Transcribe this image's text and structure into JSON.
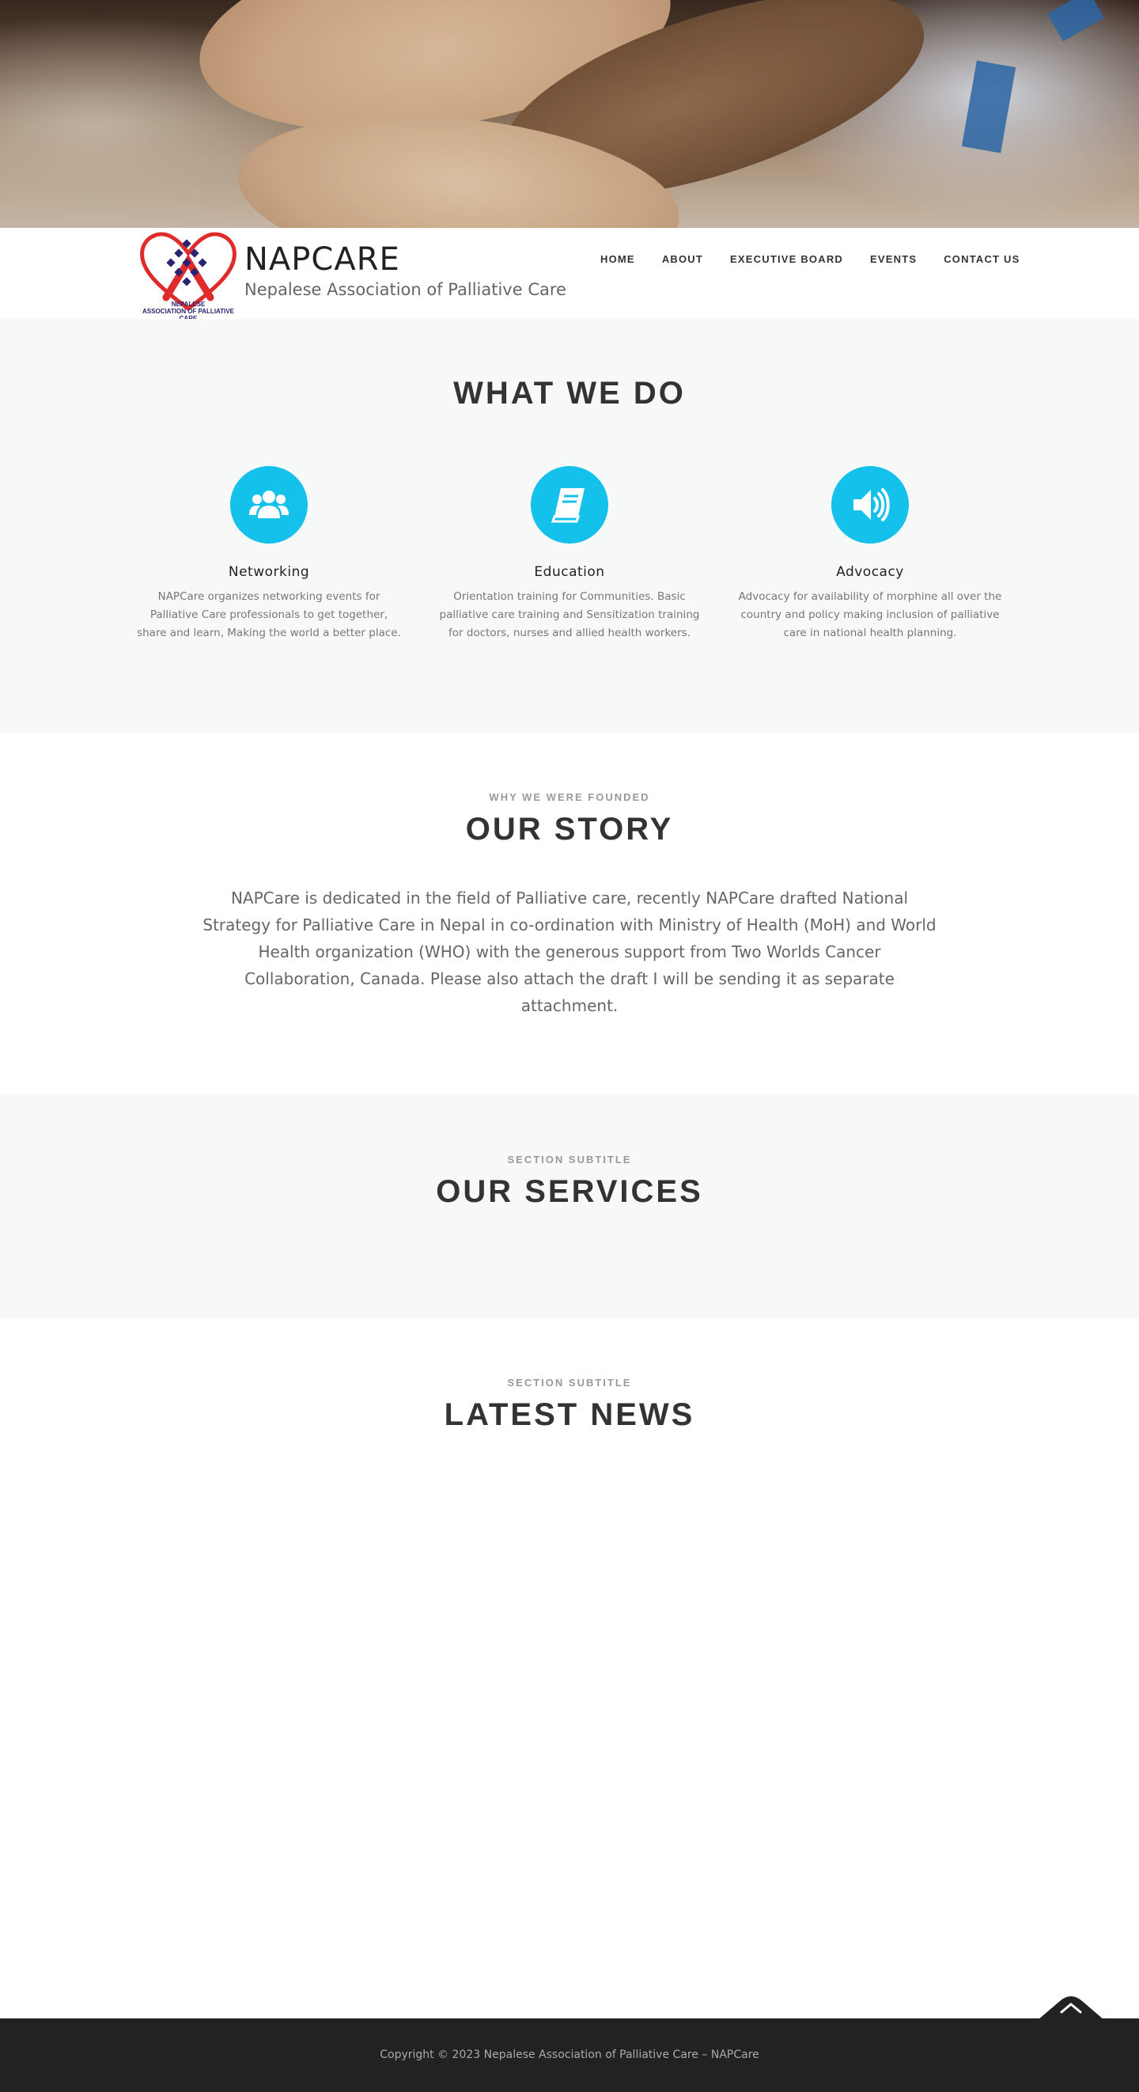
{
  "hero": {
    "image": "hands-holding-photo"
  },
  "header": {
    "logo": {
      "caption_line1": "NEPALESE",
      "caption_line2": "ASSOCIATION OF PALLIATIVE CARE",
      "caption_line3": "2016"
    },
    "site_title": "NAPCARE",
    "tagline": "Nepalese Association of Palliative Care"
  },
  "nav": {
    "items": [
      {
        "label": "HOME"
      },
      {
        "label": "ABOUT"
      },
      {
        "label": "EXECUTIVE BOARD"
      },
      {
        "label": "EVENTS"
      },
      {
        "label": "CONTACT US"
      }
    ]
  },
  "what_we_do": {
    "title": "WHAT WE DO",
    "features": [
      {
        "icon": "users-icon",
        "title": "Networking",
        "text": "NAPCare organizes networking events for Palliative Care professionals to get together, share and learn, Making the world a better place."
      },
      {
        "icon": "book-icon",
        "title": "Education",
        "text": "Orientation training for Communities. Basic palliative care training and Sensitization training for doctors, nurses and allied health workers."
      },
      {
        "icon": "volume-icon",
        "title": "Advocacy",
        "text": "Advocacy for availability of morphine all over the country and policy making inclusion of palliative care in national health planning."
      }
    ]
  },
  "story": {
    "subtitle": "WHY WE WERE FOUNDED",
    "title": "OUR STORY",
    "text": "NAPCare is dedicated in the field of Palliative care, recently NAPCare drafted National Strategy for Palliative Care in Nepal in co-ordination with Ministry of Health (MoH) and World Health organization (WHO) with the generous support from Two Worlds Cancer Collaboration, Canada. Please also attach the draft I will be sending it as separate attachment."
  },
  "services": {
    "subtitle": "SECTION SUBTITLE",
    "title": "OUR SERVICES"
  },
  "news": {
    "subtitle": "SECTION SUBTITLE",
    "title": "LATEST NEWS"
  },
  "footer": {
    "copyright": "Copyright © 2023 Nepalese Association of Palliative Care – NAPCare"
  },
  "colors": {
    "accent": "#13c1ea",
    "footer_bg": "#222222",
    "section_bg": "#f7f8f8",
    "logo_red": "#e02b2b",
    "logo_blue": "#2b2370"
  }
}
